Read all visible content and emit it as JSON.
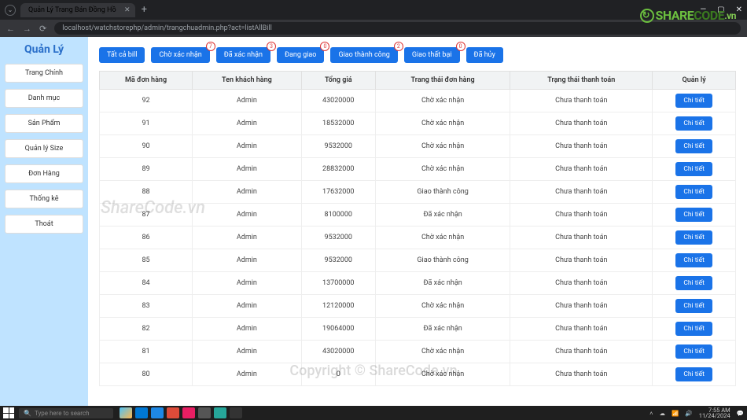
{
  "browser": {
    "tab_title": "Quản Lý Trang Bán Đồng Hồ",
    "url": "localhost/watchstorephp/admin/trangchuadmin.php?act=listAllBill",
    "window_min": "—",
    "window_max": "▢",
    "window_close": "✕",
    "tab_close": "✕",
    "tab_plus": "+"
  },
  "logo": {
    "text1": "SHARE",
    "text2": "CODE",
    "suffix": ".vn"
  },
  "sidebar": {
    "title": "Quản Lý",
    "items": [
      {
        "label": "Trang Chính"
      },
      {
        "label": "Danh mục"
      },
      {
        "label": "Sản Phẩm"
      },
      {
        "label": "Quản lý Size"
      },
      {
        "label": "Đơn Hàng"
      },
      {
        "label": "Thống kê"
      },
      {
        "label": "Thoát"
      }
    ]
  },
  "filters": [
    {
      "label": "Tất cả bill",
      "badge": null
    },
    {
      "label": "Chờ xác nhận",
      "badge": "7"
    },
    {
      "label": "Đã xác nhận",
      "badge": "3"
    },
    {
      "label": "Đang giao",
      "badge": "0"
    },
    {
      "label": "Giao thành công",
      "badge": "2"
    },
    {
      "label": "Giao thất bại",
      "badge": "0"
    },
    {
      "label": "Đã hủy",
      "badge": null
    }
  ],
  "table": {
    "headers": [
      "Mã đơn hàng",
      "Ten khách hàng",
      "Tổng giá",
      "Trang thái đơn hàng",
      "Trạng thái thanh toán",
      "Quản lý"
    ],
    "detail_label": "Chi tiết",
    "rows": [
      {
        "id": "92",
        "name": "Admin",
        "total": "43020000",
        "order_status": "Chờ xác nhận",
        "pay_status": "Chưa thanh toán"
      },
      {
        "id": "91",
        "name": "Admin",
        "total": "18532000",
        "order_status": "Chờ xác nhận",
        "pay_status": "Chưa thanh toán"
      },
      {
        "id": "90",
        "name": "Admin",
        "total": "9532000",
        "order_status": "Chờ xác nhận",
        "pay_status": "Chưa thanh toán"
      },
      {
        "id": "89",
        "name": "Admin",
        "total": "28832000",
        "order_status": "Chờ xác nhận",
        "pay_status": "Chưa thanh toán"
      },
      {
        "id": "88",
        "name": "Admin",
        "total": "17632000",
        "order_status": "Giao thành công",
        "pay_status": "Chưa thanh toán"
      },
      {
        "id": "87",
        "name": "Admin",
        "total": "8100000",
        "order_status": "Đã xác nhận",
        "pay_status": "Chưa thanh toán"
      },
      {
        "id": "86",
        "name": "Admin",
        "total": "9532000",
        "order_status": "Chờ xác nhận",
        "pay_status": "Chưa thanh toán"
      },
      {
        "id": "85",
        "name": "Admin",
        "total": "9532000",
        "order_status": "Giao thành công",
        "pay_status": "Chưa thanh toán"
      },
      {
        "id": "84",
        "name": "Admin",
        "total": "13700000",
        "order_status": "Đã xác nhận",
        "pay_status": "Chưa thanh toán"
      },
      {
        "id": "83",
        "name": "Admin",
        "total": "12120000",
        "order_status": "Chờ xác nhận",
        "pay_status": "Chưa thanh toán"
      },
      {
        "id": "82",
        "name": "Admin",
        "total": "19064000",
        "order_status": "Đã xác nhận",
        "pay_status": "Chưa thanh toán"
      },
      {
        "id": "81",
        "name": "Admin",
        "total": "43020000",
        "order_status": "Chờ xác nhận",
        "pay_status": "Chưa thanh toán"
      },
      {
        "id": "80",
        "name": "Admin",
        "total": "0",
        "order_status": "Chờ xác nhận",
        "pay_status": "Chưa thanh toán"
      }
    ]
  },
  "watermark": {
    "center": "Copyright © ShareCode.vn",
    "side": "ShareCode.vn"
  },
  "taskbar": {
    "search_placeholder": "Type here to search",
    "time": "7:55 AM",
    "date": "11/24/2024"
  }
}
